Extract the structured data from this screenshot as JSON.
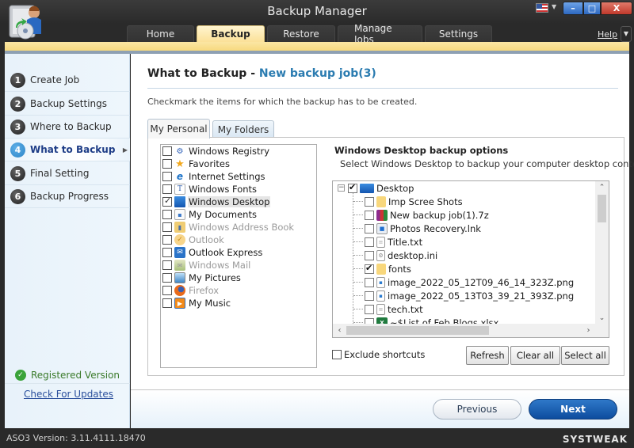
{
  "window": {
    "title": "Backup Manager",
    "language_flag": "us-flag",
    "controls": {
      "minimize": "–",
      "maximize": "□",
      "close": "X"
    }
  },
  "tabs": [
    {
      "label": "Home",
      "active": false
    },
    {
      "label": "Backup",
      "active": true
    },
    {
      "label": "Restore",
      "active": false
    },
    {
      "label": "Manage Jobs",
      "active": false
    },
    {
      "label": "Settings",
      "active": false
    }
  ],
  "help": {
    "label": "Help",
    "caret": "▼"
  },
  "sidebar": {
    "steps": [
      {
        "num": "1",
        "label": "Create Job",
        "active": false
      },
      {
        "num": "2",
        "label": "Backup Settings",
        "active": false
      },
      {
        "num": "3",
        "label": "Where to Backup",
        "active": false
      },
      {
        "num": "4",
        "label": "What to Backup",
        "active": true
      },
      {
        "num": "5",
        "label": "Final Setting",
        "active": false
      },
      {
        "num": "6",
        "label": "Backup Progress",
        "active": false
      }
    ],
    "active_arrow": "▶",
    "registered": "Registered Version",
    "check_updates": "Check For Updates"
  },
  "main": {
    "title": "What to Backup - ",
    "job_name": "New backup job(3)",
    "instructions": "Checkmark the items for which the backup has to be created.",
    "panel_tabs": [
      {
        "label": "My Personal",
        "active": true
      },
      {
        "label": "My Folders",
        "active": false
      }
    ],
    "items": [
      {
        "label": "Windows Registry",
        "checked": false,
        "enabled": true,
        "icon": "registry-icon"
      },
      {
        "label": "Favorites",
        "checked": false,
        "enabled": true,
        "icon": "star-icon"
      },
      {
        "label": "Internet Settings",
        "checked": false,
        "enabled": true,
        "icon": "internet-explorer-icon"
      },
      {
        "label": "Windows Fonts",
        "checked": false,
        "enabled": true,
        "icon": "font-icon"
      },
      {
        "label": "Windows Desktop",
        "checked": true,
        "enabled": true,
        "selected": true,
        "icon": "desktop-icon"
      },
      {
        "label": "My Documents",
        "checked": false,
        "enabled": true,
        "icon": "document-icon"
      },
      {
        "label": "Windows Address Book",
        "checked": false,
        "enabled": false,
        "icon": "address-book-icon"
      },
      {
        "label": "Outlook",
        "checked": false,
        "enabled": false,
        "icon": "outlook-icon"
      },
      {
        "label": "Outlook Express",
        "checked": false,
        "enabled": true,
        "icon": "outlook-express-icon"
      },
      {
        "label": "Windows Mail",
        "checked": false,
        "enabled": false,
        "icon": "mail-icon"
      },
      {
        "label": "My Pictures",
        "checked": false,
        "enabled": true,
        "icon": "pictures-icon"
      },
      {
        "label": "Firefox",
        "checked": false,
        "enabled": false,
        "icon": "firefox-icon"
      },
      {
        "label": "My Music",
        "checked": false,
        "enabled": true,
        "icon": "music-icon"
      }
    ],
    "options": {
      "title": "Windows Desktop backup options",
      "description": "Select Windows Desktop to backup your computer desktop contents",
      "tree_root": {
        "label": "Desktop",
        "checked": true,
        "expander": "−"
      },
      "tree_children": [
        {
          "label": "Imp Scree Shots",
          "checked": false,
          "icon": "folder-icon"
        },
        {
          "label": "New backup job(1).7z",
          "checked": false,
          "icon": "archive-icon"
        },
        {
          "label": "Photos Recovery.lnk",
          "checked": false,
          "icon": "shortcut-icon"
        },
        {
          "label": "Title.txt",
          "checked": false,
          "icon": "text-file-icon"
        },
        {
          "label": "desktop.ini",
          "checked": false,
          "icon": "settings-file-icon"
        },
        {
          "label": "fonts",
          "checked": true,
          "icon": "folder-icon"
        },
        {
          "label": "image_2022_05_12T09_46_14_323Z.png",
          "checked": false,
          "icon": "image-file-icon"
        },
        {
          "label": "image_2022_05_13T03_39_21_393Z.png",
          "checked": false,
          "icon": "image-file-icon"
        },
        {
          "label": "tech.txt",
          "checked": false,
          "icon": "text-file-icon"
        },
        {
          "label": "~$List of Feb Blogs.xlsx",
          "checked": false,
          "icon": "excel-file-icon"
        }
      ],
      "scroll": {
        "up": "⌃",
        "down": "⌄",
        "left": "‹",
        "right": "›"
      },
      "exclude_shortcuts": {
        "label": "Exclude shortcuts",
        "checked": false
      },
      "buttons": {
        "refresh": "Refresh",
        "clear_all": "Clear all",
        "select_all": "Select all"
      }
    },
    "nav": {
      "previous": "Previous",
      "next": "Next"
    }
  },
  "status": {
    "version": "ASO3 Version: 3.11.4111.18470",
    "watermark": "SYSTWEAK"
  },
  "colors": {
    "accent_yellow": "#fbe198",
    "active_step_blue": "#2b84c6",
    "job_name_blue": "#2a7bb0",
    "next_button": "#0d4c9e",
    "registered_green": "#3a7a2a"
  }
}
